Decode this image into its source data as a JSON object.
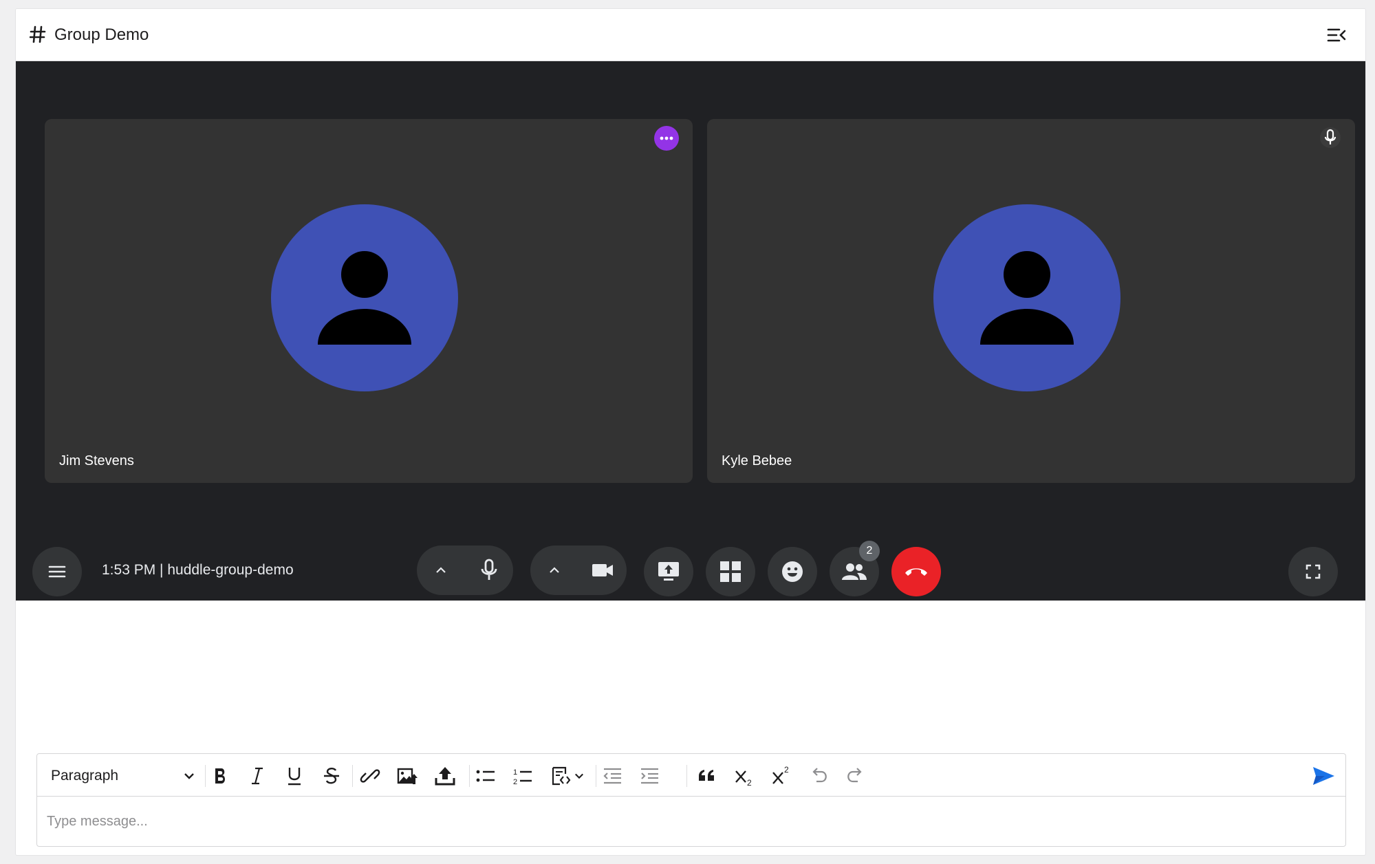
{
  "header": {
    "title": "Group Demo",
    "hash_icon": "hash-icon",
    "collapse_icon": "menu-collapse-icon"
  },
  "call": {
    "participants": [
      {
        "name": "Jim Stevens",
        "status_icon": "more-options-icon"
      },
      {
        "name": "Kyle Bebee",
        "status_icon": "microphone-icon"
      }
    ],
    "meeting_info": "1:53 PM | huddle-group-demo",
    "participant_count": "2",
    "controls": [
      "menu-icon",
      "chevron-up-icon",
      "microphone-icon",
      "chevron-up-icon",
      "camera-icon",
      "present-screen-icon",
      "layout-grid-icon",
      "emoji-icon",
      "people-icon",
      "hang-up-icon",
      "fullscreen-icon"
    ],
    "colors": {
      "call_bg": "#202124",
      "tile_bg": "#333333",
      "avatar": "#3f51b5",
      "hangup": "#ea2227",
      "more_badge": "#9334e6"
    }
  },
  "editor": {
    "block_format": "Paragraph",
    "placeholder": "Type message...",
    "value": "",
    "send_color": "#1a73e8"
  }
}
